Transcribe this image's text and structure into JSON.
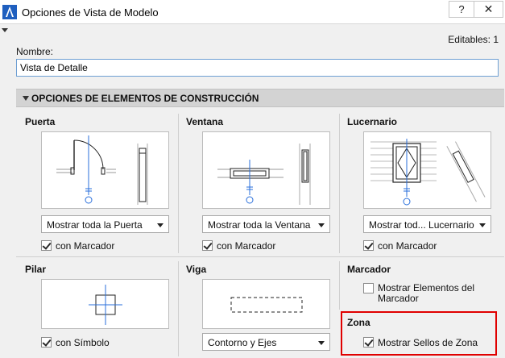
{
  "window": {
    "title": "Opciones de Vista de Modelo",
    "help_label": "?",
    "close_label": "✕"
  },
  "editables": "Editables: 1",
  "name": {
    "label": "Nombre:",
    "value": "Vista de Detalle"
  },
  "section": {
    "title": "OPCIONES DE ELEMENTOS DE CONSTRUCCIÓN"
  },
  "groups": {
    "puerta": {
      "title": "Puerta",
      "select": "Mostrar toda la Puerta",
      "checkbox": "con Marcador",
      "checked": true
    },
    "ventana": {
      "title": "Ventana",
      "select": "Mostrar toda la Ventana",
      "checkbox": "con Marcador",
      "checked": true
    },
    "lucernario": {
      "title": "Lucernario",
      "select": "Mostrar tod... Lucernario",
      "checkbox": "con Marcador",
      "checked": true
    },
    "pilar": {
      "title": "Pilar",
      "checkbox": "con Símbolo",
      "checked": true
    },
    "viga": {
      "title": "Viga",
      "select": "Contorno y Ejes"
    },
    "marcador": {
      "title": "Marcador",
      "checkbox_line1": "Mostrar Elementos del",
      "checkbox_line2": "Marcador",
      "checked": false
    },
    "zona": {
      "title": "Zona",
      "checkbox": "Mostrar Sellos de Zona",
      "checked": true
    }
  },
  "colors": {
    "accent_blue": "#2a6fdb",
    "highlight_red": "#e00000",
    "section_bg": "#d3d3d3"
  }
}
